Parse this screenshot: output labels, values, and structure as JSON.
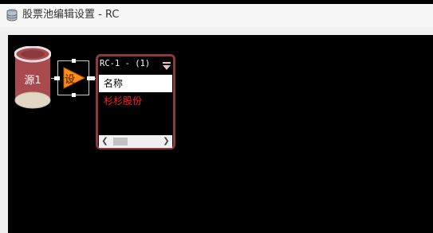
{
  "window": {
    "title": "股票池编辑设置 - RC",
    "icon": "database-icon"
  },
  "canvas": {
    "background": "#000000",
    "source_node": {
      "label": "源1",
      "icon": "cylinder-icon",
      "color": "#a84a4e"
    },
    "setter_node": {
      "label": "设",
      "icon": "triangle-icon",
      "color": "#ff8c1a"
    },
    "rc_node": {
      "title": "RC-1 - (1)",
      "border_color": "#8a3a3e",
      "column_header": "名称",
      "items": [
        {
          "label": "杉杉股份",
          "color": "#ff2020"
        }
      ]
    }
  }
}
